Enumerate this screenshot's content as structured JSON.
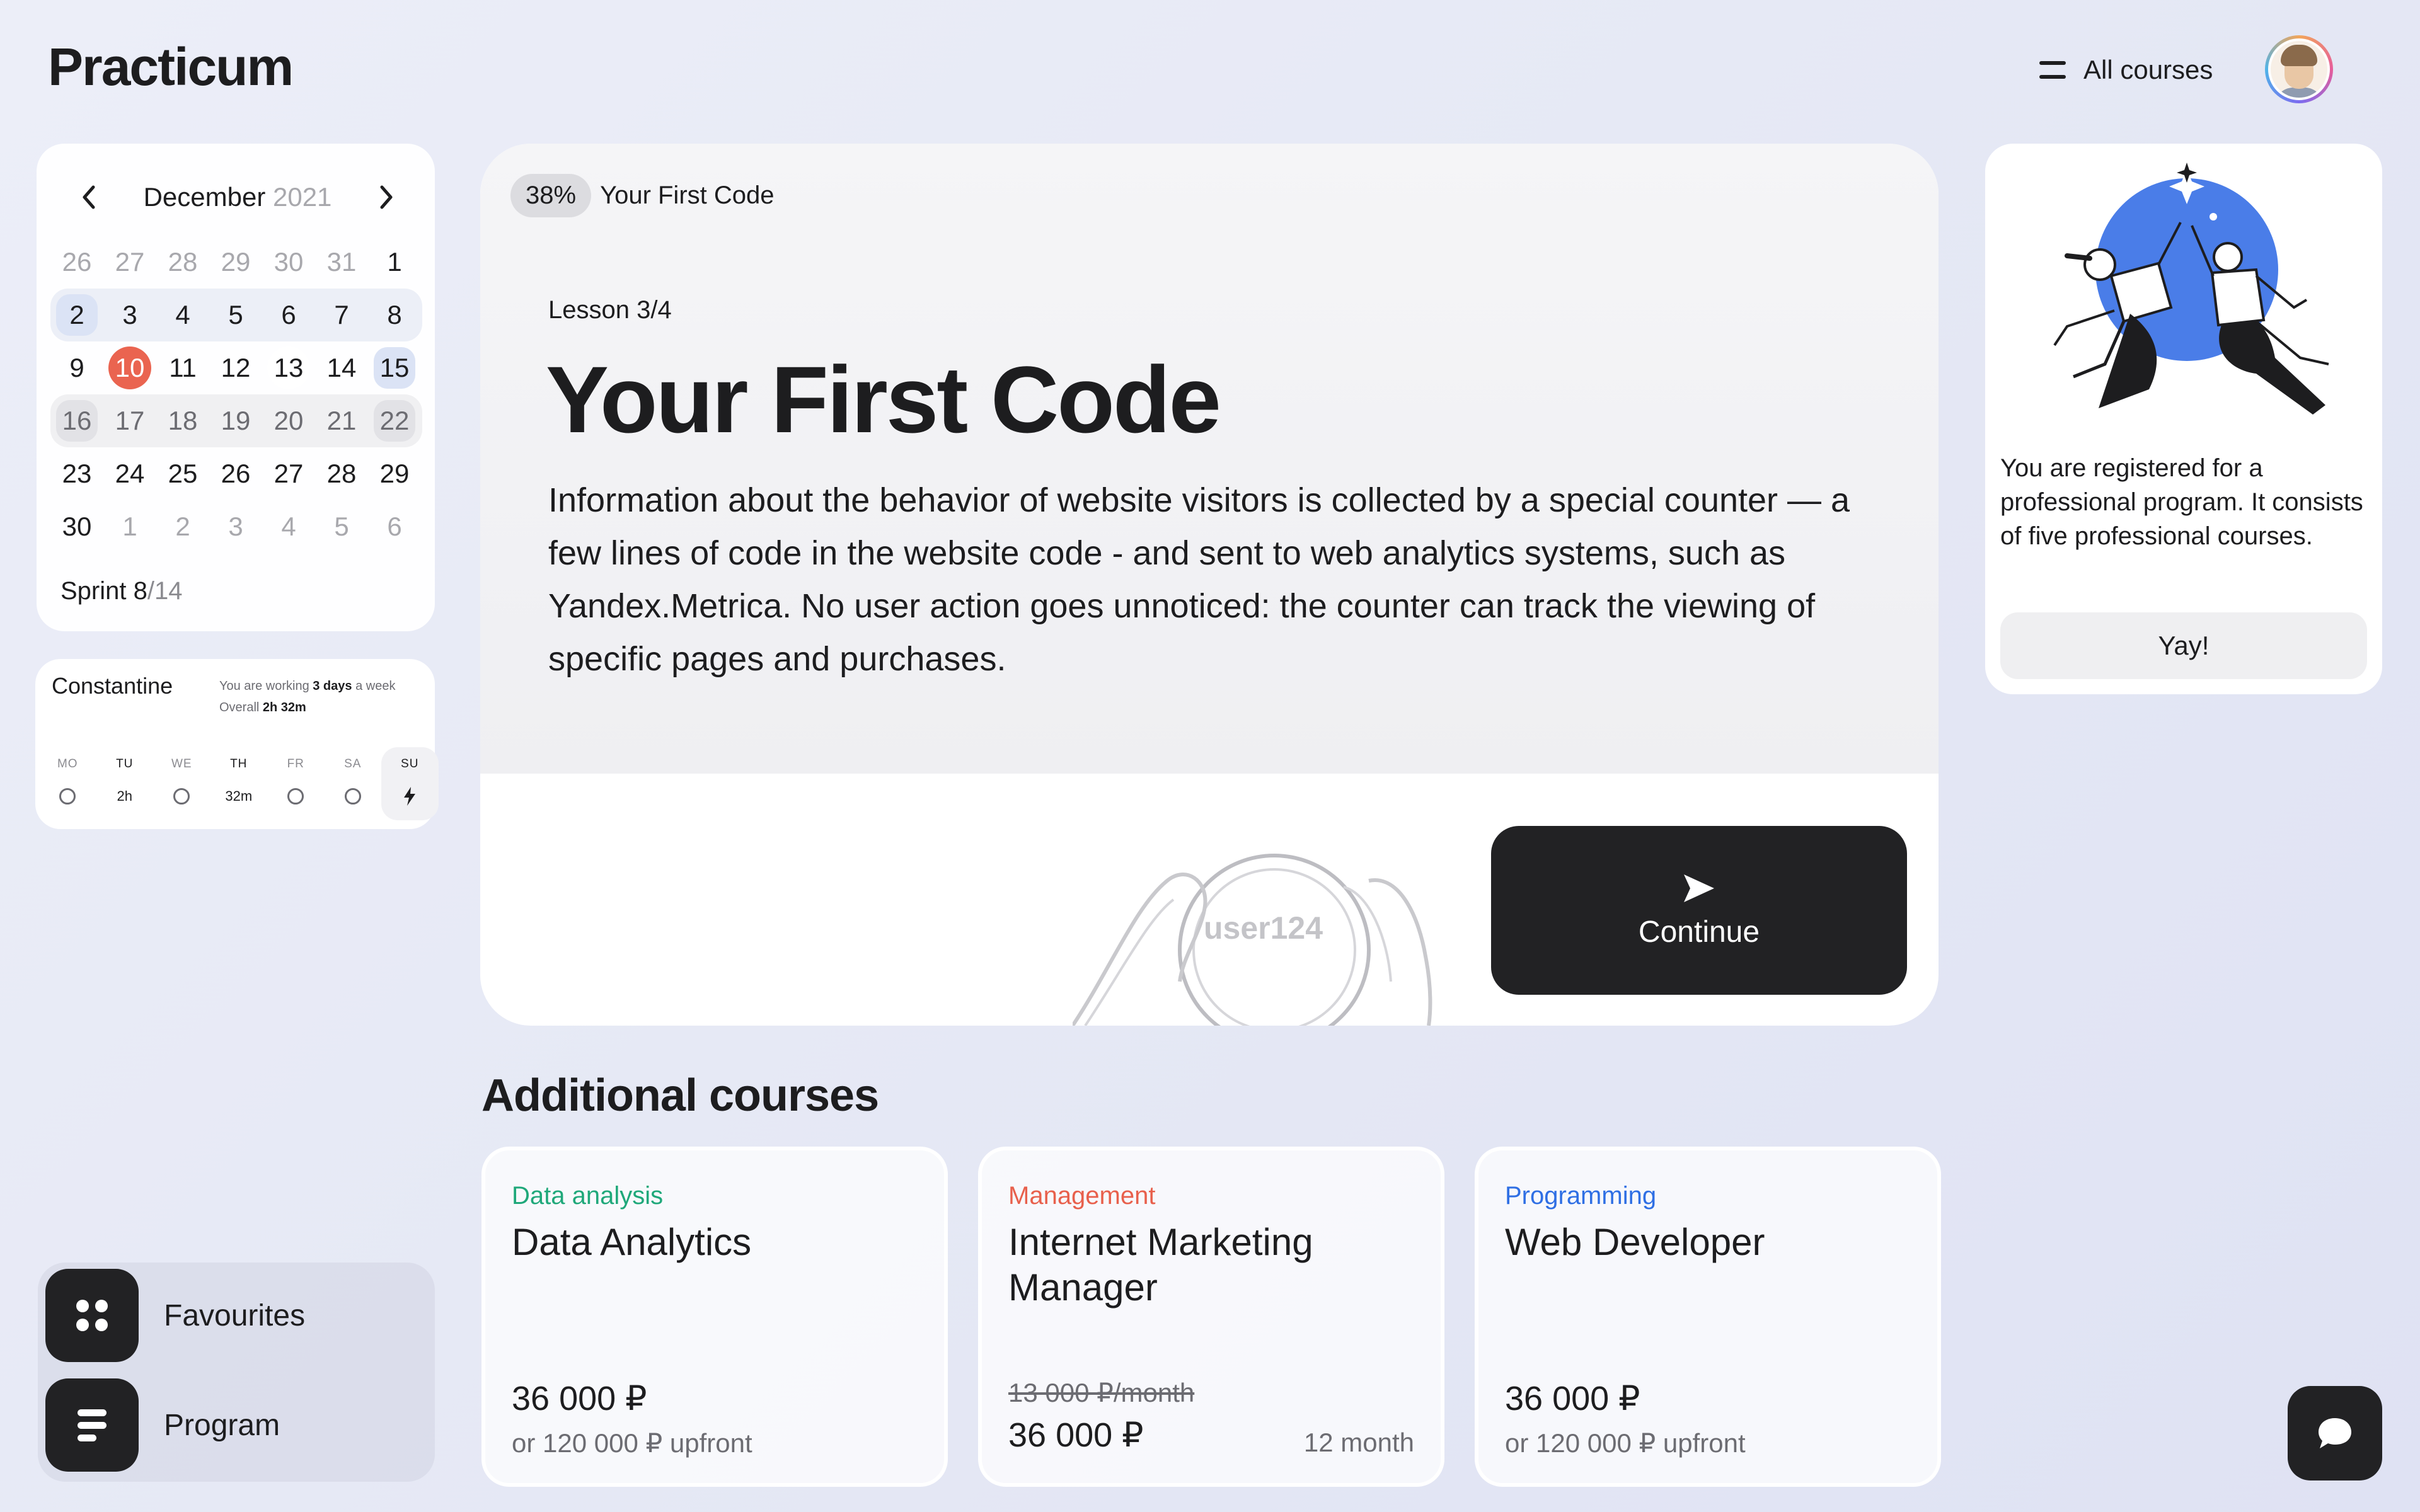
{
  "header": {
    "logo": "Practicum",
    "all_courses_label": "All courses",
    "menu_icon": "burger-icon",
    "avatar": "user-avatar"
  },
  "calendar": {
    "month": "December",
    "year": "2021",
    "weeks": [
      [
        "26",
        "27",
        "28",
        "29",
        "30",
        "31",
        "1"
      ],
      [
        "2",
        "3",
        "4",
        "5",
        "6",
        "7",
        "8"
      ],
      [
        "9",
        "10",
        "11",
        "12",
        "13",
        "14",
        "15"
      ],
      [
        "16",
        "17",
        "18",
        "19",
        "20",
        "21",
        "22"
      ],
      [
        "23",
        "24",
        "25",
        "26",
        "27",
        "28",
        "29"
      ],
      [
        "30",
        "1",
        "2",
        "3",
        "4",
        "5",
        "6"
      ]
    ],
    "today": "10",
    "sprint_label": "Sprint 8",
    "sprint_total": "/14",
    "prev_icon": "chevron-left-icon",
    "next_icon": "chevron-right-icon"
  },
  "activity": {
    "name": "Constantine",
    "working_prefix": "You are working ",
    "working_days": "3 days",
    "working_suffix": " a week",
    "overall_prefix": "Overall ",
    "overall_value": "2h 32m",
    "days": [
      {
        "label": "MO",
        "value": ""
      },
      {
        "label": "TU",
        "value": "2h"
      },
      {
        "label": "WE",
        "value": ""
      },
      {
        "label": "TH",
        "value": "32m"
      },
      {
        "label": "FR",
        "value": ""
      },
      {
        "label": "SA",
        "value": ""
      },
      {
        "label": "SU",
        "value": ""
      }
    ]
  },
  "nav": {
    "favourites": "Favourites",
    "program": "Program"
  },
  "lesson": {
    "progress": "38%",
    "crumb_title": "Your First Code",
    "lesson_num": "Lesson 3/4",
    "title": "Your First Code",
    "description": "Information about the behavior of website visitors is collected by a special counter — a few lines of code in the website code - and sent to web analytics systems, such as Yandex.Metrica. No user action goes unnoticed: the counter can track the viewing of specific pages and purchases.",
    "illustration_tag": "user124",
    "continue_label": "Continue"
  },
  "promo": {
    "text": "You are registered for a professional program. It consists of five professional courses.",
    "button": "Yay!"
  },
  "additional": {
    "title": "Additional courses",
    "courses": [
      {
        "tag": "Data analysis",
        "tag_color": "#1fa87a",
        "name": "Data Analytics",
        "price": "36 000 ₽",
        "sub": "or 120 000 ₽ upfront"
      },
      {
        "tag": "Management",
        "tag_color": "#e8604c",
        "name": "Internet Marketing Manager",
        "old_price": "13 000 ₽/month",
        "price": "36 000 ₽",
        "duration": "12 month"
      },
      {
        "tag": "Programming",
        "tag_color": "#2f6fe4",
        "name": "Web Developer",
        "price": "36 000 ₽",
        "sub": "or 120 000 ₽ upfront"
      }
    ]
  },
  "colors": {
    "accent_dark": "#222224",
    "today_red": "#ea6450",
    "illustration_blue": "#4a7de8"
  }
}
